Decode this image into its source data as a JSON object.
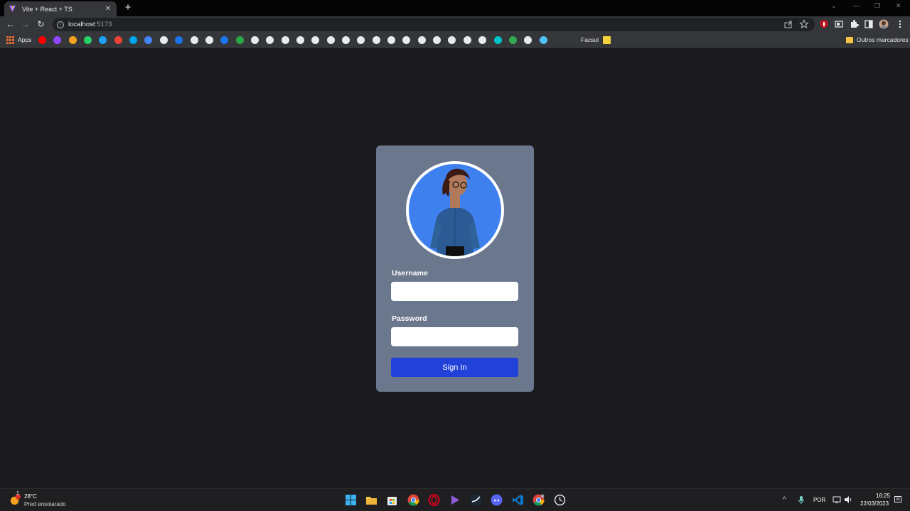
{
  "browser": {
    "tab": {
      "title": "Vite + React + TS",
      "close": "✕"
    },
    "new_tab": "+",
    "window_controls": {
      "collapse": "⌄",
      "minimize": "—",
      "restore": "❐",
      "close": "✕"
    },
    "nav": {
      "back": "←",
      "forward": "→",
      "reload": "↻"
    },
    "url": {
      "host": "localhost",
      "port": ":5173",
      "info": "i"
    },
    "bookmarks": {
      "apps_label": "Apps",
      "facsul_label": "Facsul",
      "other_label": "Outros marcadores",
      "icon_colors": [
        "#ff0000",
        "#9146ff",
        "#f6a21e",
        "#25d366",
        "#1da1f2",
        "#ea4335",
        "#00a4ef",
        "#4285f4",
        "#e8eaed",
        "#1a73e8",
        "#e8eaed",
        "#e8eaed",
        "#1877f2",
        "#2ba84a",
        "#e8eaed",
        "#e8eaed",
        "#e8eaed",
        "#e8eaed",
        "#e8eaed",
        "#e8eaed",
        "#e8eaed",
        "#e8eaed",
        "#e8eaed",
        "#e8eaed",
        "#e8eaed",
        "#e8eaed",
        "#e8eaed",
        "#e8eaed",
        "#e8eaed",
        "#e8eaed",
        "#00c4cc",
        "#34a853",
        "#e8eaed",
        "#4fc3f7"
      ]
    }
  },
  "login": {
    "username_label": "Username",
    "password_label": "Password",
    "sign_in_label": "Sign In",
    "accent_color": "#2241d8",
    "card_color": "#6b778d"
  },
  "taskbar": {
    "weather": {
      "temp": "28°C",
      "desc": "Pred ensolarado",
      "badge": "1"
    },
    "apps": [
      "start-icon",
      "file-explorer-icon",
      "ms-store-icon",
      "chrome-icon",
      "opera-icon",
      "media-player-icon",
      "steam-icon",
      "discord-icon",
      "vscode-icon",
      "chrome-canary-icon",
      "clock-icon"
    ],
    "tray": {
      "caret": "^",
      "language": "POR",
      "time": "16:25",
      "date": "22/03/2023"
    }
  }
}
